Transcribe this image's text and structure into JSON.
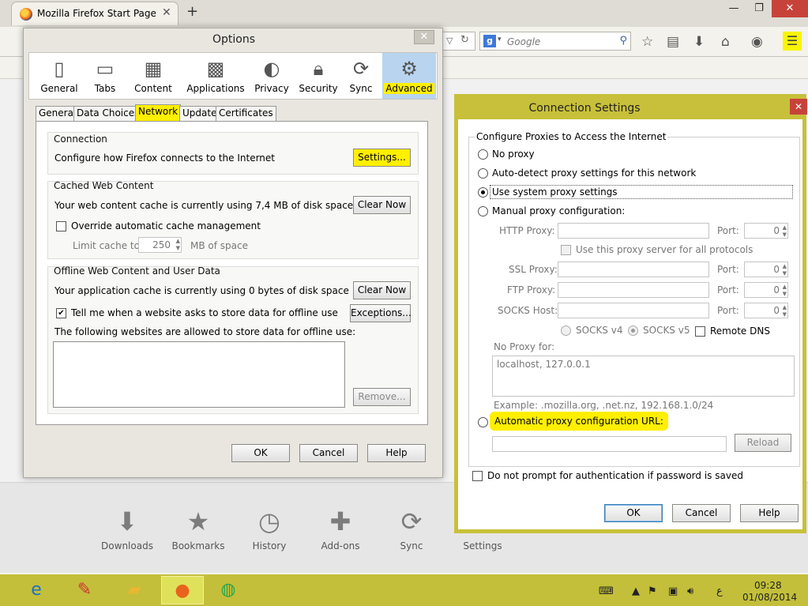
{
  "browser": {
    "tab_title": "Mozilla Firefox Start Page",
    "tab_close": "✕",
    "new_tab": "+",
    "search_engine_label": "g",
    "search_placeholder": "Google",
    "win_minimize": "—",
    "win_restore": "❐",
    "win_close": "✕"
  },
  "launch_bar": {
    "items": [
      "Downloads",
      "Bookmarks",
      "History",
      "Add-ons",
      "Sync",
      "Settings"
    ]
  },
  "options": {
    "title": "Options",
    "close": "✕",
    "panes": [
      "General",
      "Tabs",
      "Content",
      "Applications",
      "Privacy",
      "Security",
      "Sync",
      "Advanced"
    ],
    "subtabs": [
      "General",
      "Data Choices",
      "Network",
      "Update",
      "Certificates"
    ],
    "connection": {
      "label": "Connection",
      "desc": "Configure how Firefox connects to the Internet",
      "settings_button": "Settings..."
    },
    "cache": {
      "label": "Cached Web Content",
      "desc": "Your web content cache is currently using 7,4 MB of disk space",
      "clear_button": "Clear Now",
      "override_label": "Override automatic cache management",
      "limit_label": "Limit cache to",
      "limit_value": "250",
      "limit_unit": "MB of space"
    },
    "offline": {
      "label": "Offline Web Content and User Data",
      "desc": "Your application cache is currently using 0 bytes of disk space",
      "clear_button": "Clear Now",
      "tell_label": "Tell me when a website asks to store data for offline use",
      "exceptions_button": "Exceptions...",
      "allowed_label": "The following websites are allowed to store data for offline use:",
      "remove_button": "Remove..."
    },
    "ok": "OK",
    "cancel": "Cancel",
    "help": "Help"
  },
  "conn": {
    "title": "Connection Settings",
    "close": "✕",
    "group_label": "Configure Proxies to Access the Internet",
    "no_proxy": "No proxy",
    "auto_detect": "Auto-detect proxy settings for this network",
    "use_system": "Use system proxy settings",
    "manual": "Manual proxy configuration:",
    "http_label": "HTTP Proxy:",
    "ssl_label": "SSL Proxy:",
    "ftp_label": "FTP Proxy:",
    "socks_label": "SOCKS Host:",
    "port_label": "Port:",
    "port_value": "0",
    "use_all": "Use this proxy server for all protocols",
    "socks4": "SOCKS v4",
    "socks5": "SOCKS v5",
    "remote_dns": "Remote DNS",
    "no_proxy_for": "No Proxy for:",
    "no_proxy_value": "localhost, 127.0.0.1",
    "example": "Example: .mozilla.org, .net.nz, 192.168.1.0/24",
    "auto_url": "Automatic proxy configuration URL:",
    "reload": "Reload",
    "no_prompt": "Do not prompt for authentication if password is saved",
    "ok": "OK",
    "cancel": "Cancel",
    "help": "Help"
  },
  "taskbar": {
    "time": "09:28",
    "date": "01/08/2014",
    "lang": "ع"
  },
  "colors": {
    "highlight": "#ffef00",
    "taskbar": "#c3bf3a",
    "close_red": "#c7433a"
  }
}
